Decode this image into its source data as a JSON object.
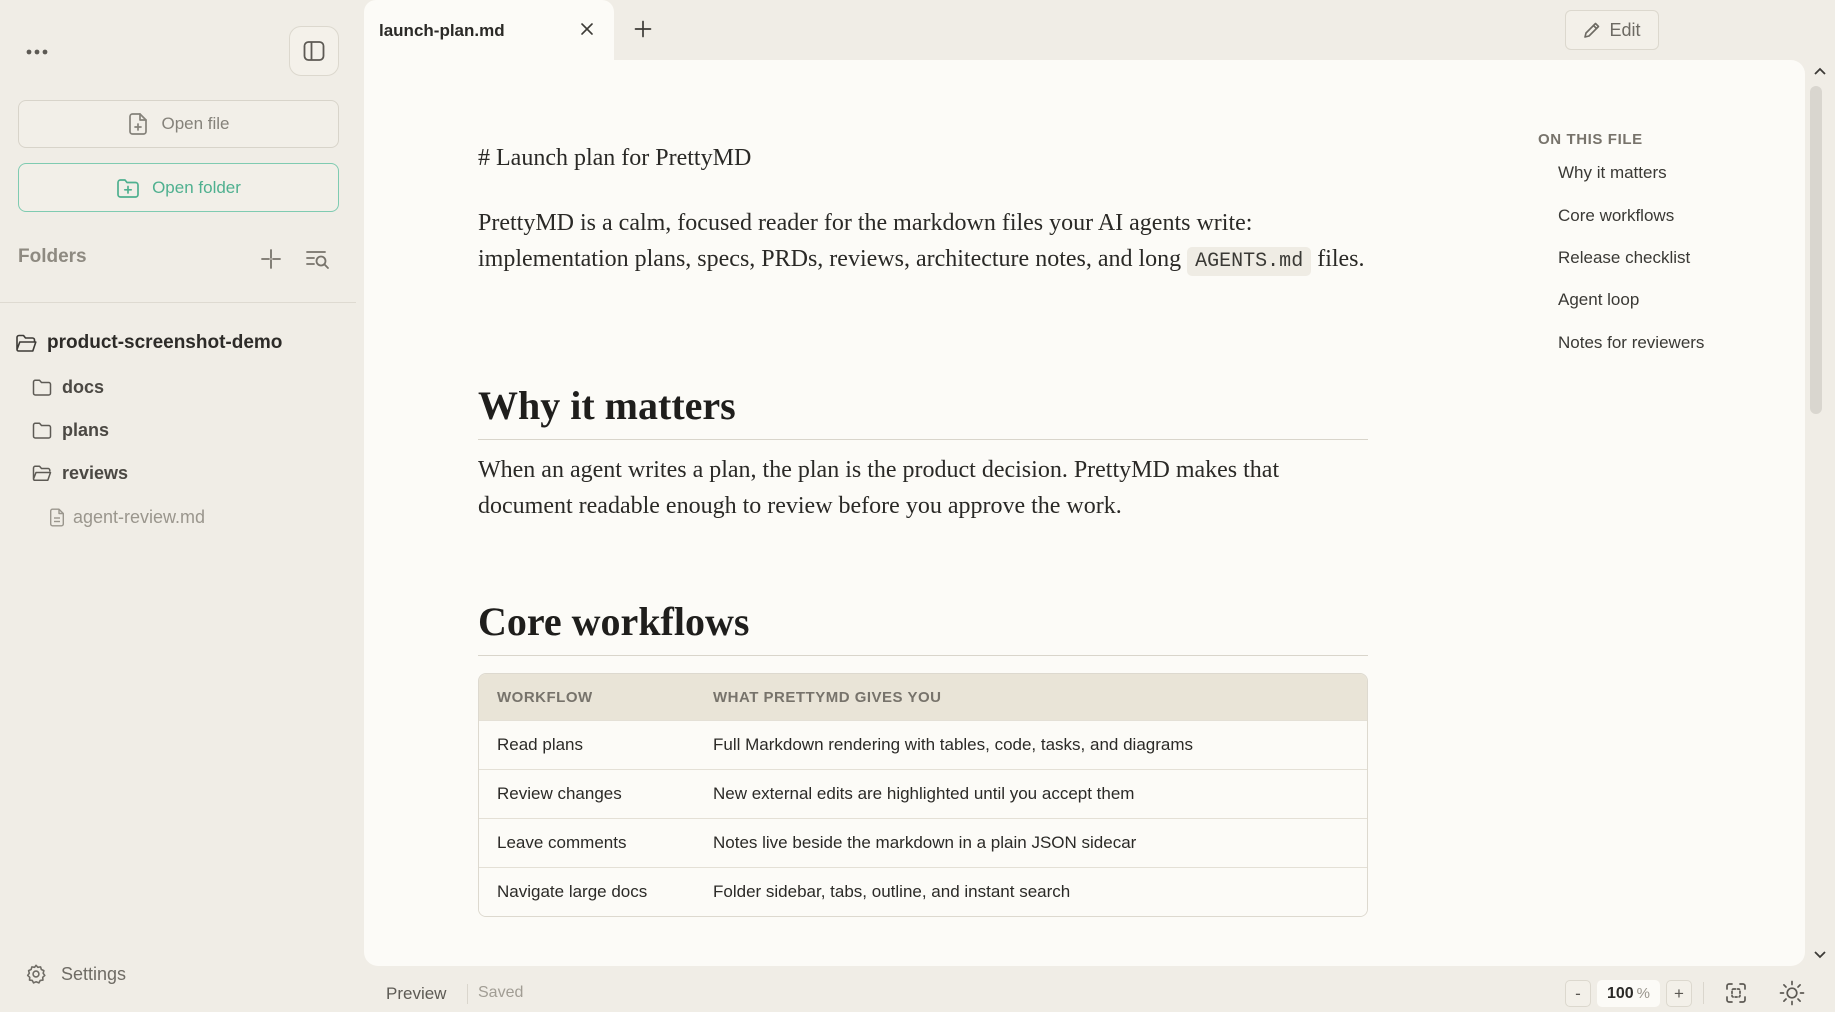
{
  "sidebar": {
    "open_file_label": "Open file",
    "open_folder_label": "Open folder",
    "folders_label": "Folders",
    "tree": {
      "root": "product-screenshot-demo",
      "folders": [
        "docs",
        "plans",
        "reviews"
      ],
      "file": "agent-review.md"
    },
    "settings_label": "Settings"
  },
  "tabs": {
    "active_title": "launch-plan.md"
  },
  "toolbar": {
    "edit_label": "Edit"
  },
  "document": {
    "raw_heading": "# Launch plan for PrettyMD",
    "intro_before_code": "PrettyMD is a calm, focused reader for the markdown files your AI agents write: implementation plans, specs, PRDs, reviews, architecture notes, and long ",
    "intro_code": "AGENTS.md",
    "intro_after_code": " files.",
    "section1": {
      "heading": "Why it matters",
      "body": "When an agent writes a plan, the plan is the product decision. PrettyMD makes that document readable enough to review before you approve the work."
    },
    "section2": {
      "heading": "Core workflows",
      "table": {
        "headers": [
          "WORKFLOW",
          "WHAT PRETTYMD GIVES YOU"
        ],
        "rows": [
          [
            "Read plans",
            "Full Markdown rendering with tables, code, tasks, and diagrams"
          ],
          [
            "Review changes",
            "New external edits are highlighted until you accept them"
          ],
          [
            "Leave comments",
            "Notes live beside the markdown in a plain JSON sidecar"
          ],
          [
            "Navigate large docs",
            "Folder sidebar, tabs, outline, and instant search"
          ]
        ]
      }
    }
  },
  "outline": {
    "title": "ON THIS FILE",
    "items": [
      "Why it matters",
      "Core workflows",
      "Release checklist",
      "Agent loop",
      "Notes for reviewers"
    ]
  },
  "statusbar": {
    "mode": "Preview",
    "save_state": "Saved",
    "zoom_value": "100",
    "zoom_unit": "%",
    "zoom_minus": "-",
    "zoom_plus": "+"
  },
  "colors": {
    "accent": "#4fb08f",
    "accent_border": "#7fcbb1",
    "app_background": "#f0ede6",
    "content_background": "#fcfbf7",
    "table_header": "#e9e4d7"
  },
  "icons": [
    "more-icon",
    "sidebar-toggle-icon",
    "file-plus-icon",
    "folder-plus-icon",
    "collapse-icon",
    "search-list-icon",
    "folder-open-icon",
    "folder-icon",
    "file-icon",
    "gear-icon",
    "close-icon",
    "plus-icon",
    "pencil-icon",
    "fit-screen-icon",
    "sun-icon",
    "chevron-up-icon",
    "chevron-down-icon"
  ]
}
